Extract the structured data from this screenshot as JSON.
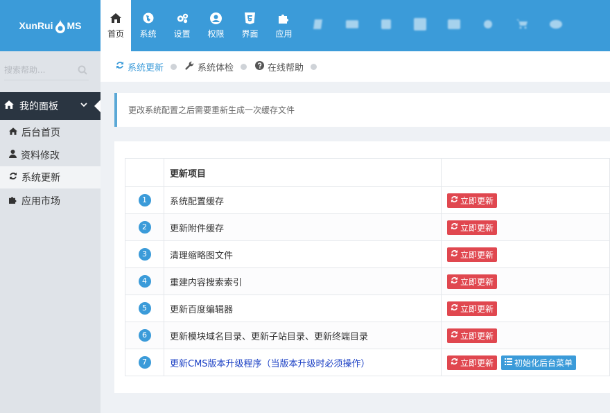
{
  "logo": {
    "text_a": "XunRui",
    "text_b": "MS"
  },
  "nav": [
    {
      "label": "首页",
      "icon": "home-icon",
      "active": true
    },
    {
      "label": "系统",
      "icon": "globe-icon"
    },
    {
      "label": "设置",
      "icon": "cogs-icon"
    },
    {
      "label": "权限",
      "icon": "user-circle-icon"
    },
    {
      "label": "界面",
      "icon": "html5-icon"
    },
    {
      "label": "应用",
      "icon": "puzzle-icon"
    }
  ],
  "sidebar": {
    "search_placeholder": "搜索帮助...",
    "menu_head": "我的面板",
    "items": [
      {
        "label": "后台首页",
        "icon": "home-icon"
      },
      {
        "label": "资料修改",
        "icon": "user-icon"
      },
      {
        "label": "系统更新",
        "icon": "refresh-icon",
        "active": true
      },
      {
        "label": "应用市场",
        "icon": "puzzle-icon"
      }
    ]
  },
  "tabs": [
    {
      "label": "系统更新",
      "icon": "refresh-icon",
      "active": true
    },
    {
      "label": "系统体检",
      "icon": "wrench-icon"
    },
    {
      "label": "在线帮助",
      "icon": "question-icon"
    }
  ],
  "notice": "更改系统配置之后需要重新生成一次缓存文件",
  "table": {
    "header": "更新项目",
    "update_label": "立即更新",
    "init_label": "初始化后台菜单",
    "rows": [
      {
        "num": "1",
        "name": "系统配置缓存"
      },
      {
        "num": "2",
        "name": "更新附件缓存"
      },
      {
        "num": "3",
        "name": "清理缩略图文件"
      },
      {
        "num": "4",
        "name": "重建内容搜索索引"
      },
      {
        "num": "5",
        "name": "更新百度编辑器"
      },
      {
        "num": "6",
        "name": "更新模块域名目录、更新子站目录、更新终端目录"
      },
      {
        "num": "7",
        "name": "更新CMS版本升级程序（当版本升级时必须操作）",
        "highlight": true
      }
    ]
  },
  "colors": {
    "topbar": "#3b9bd9",
    "sidebar_head": "#2a3541",
    "danger": "#e0474f",
    "primary": "#3b9bd9",
    "link": "#1a3fc4"
  }
}
